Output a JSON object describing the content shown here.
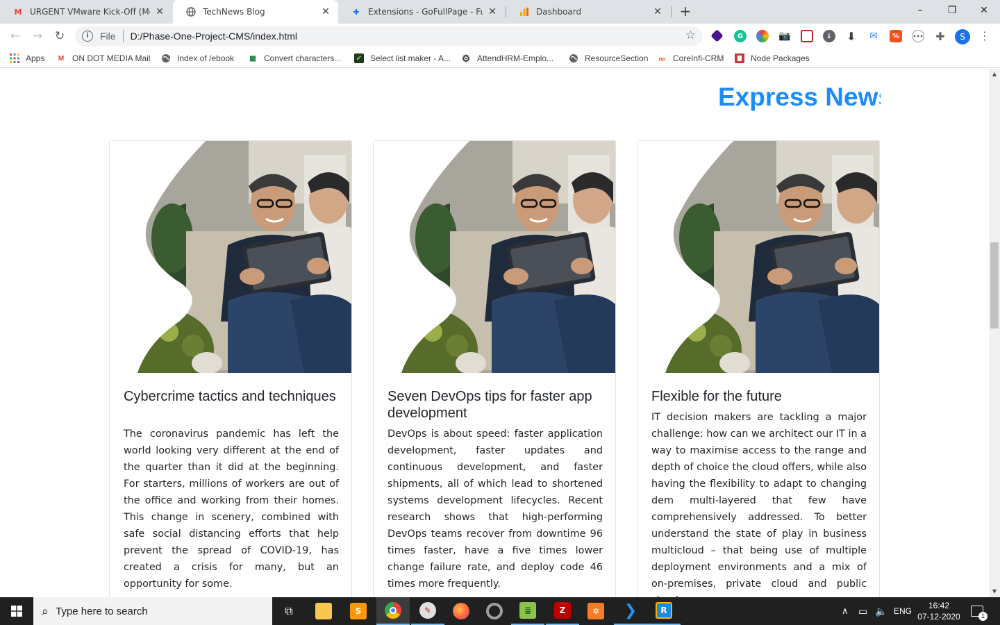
{
  "browser": {
    "tabs": [
      {
        "title": "URGENT VMware Kick-Off (Moar",
        "favicon": "gmail-icon",
        "active": false
      },
      {
        "title": "TechNews Blog",
        "favicon": "globe-icon",
        "active": true
      },
      {
        "title": "Extensions - GoFullPage - Full Pa",
        "favicon": "puzzle-icon",
        "active": false
      },
      {
        "title": "Dashboard",
        "favicon": "chart-icon",
        "active": false
      }
    ],
    "new_tab_symbol": "+",
    "window_controls": {
      "minimize": "–",
      "maximize": "❐",
      "close": "✕"
    },
    "address": {
      "scheme": "File",
      "url": "D:/Phase-One-Project-CMS/index.html"
    },
    "profile_initial": "S"
  },
  "bookmarks": [
    {
      "label": "Apps",
      "icon": "apps-grid-icon"
    },
    {
      "label": "ON DOT MEDIA Mail",
      "icon": "gmail-icon"
    },
    {
      "label": "Index of /ebook",
      "icon": "globe-icon"
    },
    {
      "label": "Convert characters...",
      "icon": "converter-icon"
    },
    {
      "label": "Select list maker - A...",
      "icon": "checkmark-icon"
    },
    {
      "label": "AttendHRM-Emplo...",
      "icon": "gear-icon"
    },
    {
      "label": "ResourceSection",
      "icon": "globe-icon"
    },
    {
      "label": "CoreInfi-CRM",
      "icon": "link-icon"
    },
    {
      "label": "Node Packages",
      "icon": "npm-icon"
    }
  ],
  "page": {
    "brand": "Express News",
    "brand_color": "#1a8cff",
    "cards": [
      {
        "title": "Cybercrime tactics and techniques",
        "body": "The coronavirus pandemic has left the world looking very different at the end of the quarter than it did at the beginning. For starters, millions of workers are out of the office and working from their homes. This change in scenery, combined with safe social distancing efforts that help prevent the spread of COVID-19, has created a crisis for many, but an opportunity for some."
      },
      {
        "title": "Seven DevOps tips for faster app development",
        "body": "DevOps is about speed: faster application development, faster updates and continuous development, and faster shipments, all of which lead to shortened systems development lifecycles. Recent research shows that high-performing DevOps teams recover from downtime 96 times faster, have a five times lower change failure rate, and deploy code 46 times more frequently."
      },
      {
        "title": "Flexible for the future",
        "body": "IT decision makers are tackling a major challenge: how can we architect our IT in a way to maximise access to the range and depth of choice the cloud offers, while also having the flexibility to adapt to changing dem multi-layered that few have comprehensively addressed. To better understand the state of play in business multicloud – that being use of multiple deployment environments and a mix of on-premises, private cloud and public cloud"
      }
    ]
  },
  "taskbar": {
    "search_placeholder": "Type here to search",
    "language": "ENG",
    "time": "16:42",
    "date": "07-12-2020",
    "notification_count": "1"
  }
}
